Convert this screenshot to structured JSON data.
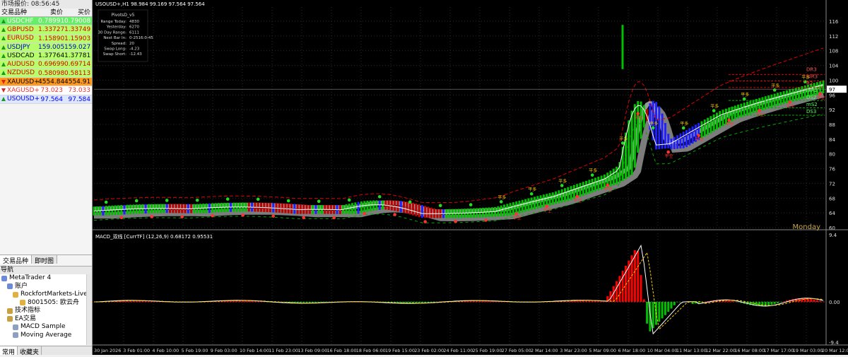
{
  "market_watch": {
    "title": "市场报价: 08:56:45",
    "headers": {
      "symbol": "交易品种",
      "bid": "卖价",
      "ask": "买价"
    },
    "rows": [
      {
        "symbol": "USDCHF",
        "bid": "0.78991",
        "ask": "0.79008",
        "bg": "#66ee66",
        "text": "#fff",
        "dir": "up"
      },
      {
        "symbol": "GBPUSD",
        "bid": "1.33727",
        "ask": "1.33749",
        "bg": "#b6ff6b",
        "text": "#d00",
        "dir": "up"
      },
      {
        "symbol": "EURUSD",
        "bid": "1.15890",
        "ask": "1.15903",
        "bg": "#b6ff6b",
        "text": "#d00",
        "dir": "up"
      },
      {
        "symbol": "USDJPY",
        "bid": "159.005",
        "ask": "159.027",
        "bg": "#b6ff6b",
        "text": "#0000cc",
        "dir": "up"
      },
      {
        "symbol": "USDCAD",
        "bid": "1.37764",
        "ask": "1.37781",
        "bg": "#b6ff6b",
        "text": "#000",
        "dir": "up"
      },
      {
        "symbol": "AUDUSD",
        "bid": "0.69699",
        "ask": "0.69714",
        "bg": "#b6ff6b",
        "text": "#d00",
        "dir": "up"
      },
      {
        "symbol": "NZDUSD",
        "bid": "0.58098",
        "ask": "0.58113",
        "bg": "#b6ff6b",
        "text": "#d00",
        "dir": "up"
      },
      {
        "symbol": "XAUUSD+",
        "bid": "4554.84",
        "ask": "4554.91",
        "bg": "#ff9a1e",
        "text": "#000",
        "dir": "down"
      },
      {
        "symbol": "XAGUSD+",
        "bid": "73.023",
        "ask": "73.033",
        "bg": "#ffffff",
        "text": "#e33",
        "dir": "down"
      },
      {
        "symbol": "USOUSD+",
        "bid": "97.564",
        "ask": "97.584",
        "bg": "#dde6ff",
        "text": "#0000ee",
        "dir": "up"
      }
    ],
    "tabs": [
      "交易品种",
      "即时图"
    ]
  },
  "navigator": {
    "title": "导航",
    "items": [
      {
        "label": "MetaTrader 4",
        "indent": 2,
        "icon": "#6b8bd6"
      },
      {
        "label": "账户",
        "indent": 10,
        "icon": "#6b8bd6"
      },
      {
        "label": "RockfortMarkets-Live",
        "indent": 18,
        "icon": "#e0b040"
      },
      {
        "label": "8001505: 欧云舟",
        "indent": 28,
        "icon": "#e0b040"
      },
      {
        "label": "技术指标",
        "indent": 10,
        "icon": "#c8a040"
      },
      {
        "label": "EA交易",
        "indent": 10,
        "icon": "#c8a040"
      },
      {
        "label": "MACD Sample",
        "indent": 18,
        "icon": "#8da0c0"
      },
      {
        "label": "Moving Average",
        "indent": 18,
        "icon": "#8da0c0"
      }
    ],
    "tabs": [
      "常用",
      "收藏夹"
    ]
  },
  "chart": {
    "header": "USOUSD+,H1  98.984 99.169 97.564 97.564",
    "pivot_box": {
      "title": "PivotsD_v5",
      "rows": [
        {
          "k": "Range Today:",
          "v": "4830"
        },
        {
          "k": "Yesterday:",
          "v": "6270"
        },
        {
          "k": "30 Day Range:",
          "v": "6111"
        },
        {
          "k": "Next Bar In:",
          "v": "0-2516:0-45"
        },
        {
          "k": "Spread:",
          "v": "20"
        },
        {
          "k": "Swap Long:",
          "v": "-4.23"
        },
        {
          "k": "Swap Short:",
          "v": "-12.43"
        }
      ]
    },
    "macd_header": "MACD_双线 [CurrTF] (12,26,9) 0.68172 0.95531",
    "watermark": "Monday",
    "price_labels": [
      "116",
      "112",
      "108",
      "104",
      "100",
      "96",
      "92",
      "88",
      "84",
      "80",
      "76",
      "72",
      "68",
      "64",
      "60"
    ],
    "level_labels": [
      "DR3",
      "mR3",
      "R2",
      "mR2",
      "DS2",
      "mS2",
      "DS3"
    ],
    "macd_labels": [
      "9.4",
      "0.00",
      "-9.4"
    ],
    "current_price": "97",
    "time_labels": [
      "30 Jan 2026",
      "3 Feb 01:00",
      "4 Feb 10:00",
      "5 Feb 19:00",
      "9 Feb 03:00",
      "10 Feb 14:00",
      "11 Feb 23:00",
      "13 Feb 09:00",
      "16 Feb 18:00",
      "18 Feb 06:00",
      "19 Feb 15:00",
      "23 Feb 02:00",
      "24 Feb 11:00",
      "25 Feb 19:00",
      "27 Feb 05:00",
      "2 Mar 14:00",
      "3 Mar 23:00",
      "5 Mar 09:00",
      "6 Mar 18:00",
      "10 Mar 04:00",
      "11 Mar 13:00",
      "12 Mar 22:00",
      "16 Mar 08:00",
      "17 Mar 17:00",
      "19 Mar 03:00",
      "20 Mar 12:00"
    ],
    "colors": {
      "bull": "#00c000",
      "bear": "#c00000",
      "blue": "#2020ff",
      "grey": "#8a8a8a",
      "yellow": "#ffd000"
    }
  }
}
